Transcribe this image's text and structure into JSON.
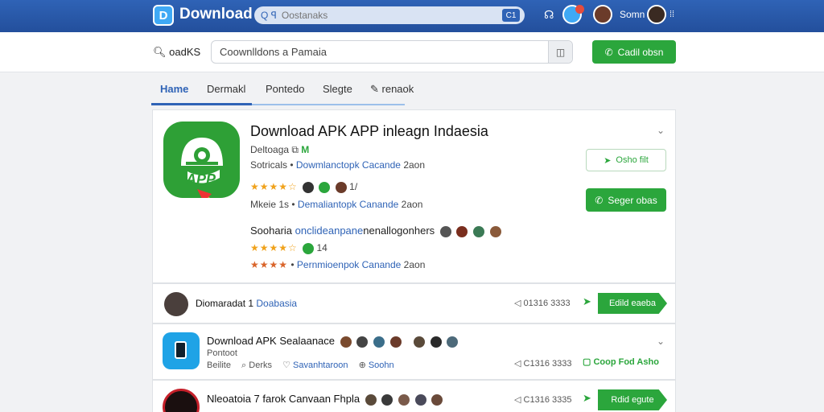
{
  "topbar": {
    "logo_glyph": "D",
    "brand": "Download",
    "search_icon_text": "Q ꟼ",
    "search_placeholder": "Oostanaks",
    "search_btn": "C1",
    "user": "Somn",
    "menu_glyph": "⁞⁞"
  },
  "searchbar": {
    "label": "oadKS",
    "value": "Coownlldons a Pamaia",
    "action_label": "Cadil obsn"
  },
  "tabs": [
    {
      "label": "Hame",
      "active": true
    },
    {
      "label": "Dermakl",
      "active": false
    },
    {
      "label": "Pontedo",
      "active": false
    },
    {
      "label": "Slegte",
      "active": false
    },
    {
      "label": "renaok",
      "active": false
    }
  ],
  "hero": {
    "title": "Download APK APP inleagn Indaesia",
    "meta1_label": "Deltoaga",
    "meta1_tag": "M",
    "meta2_label": "Sotricals",
    "meta2_link": "Dowmlanctopk Cacande",
    "meta2_tail": "2aon",
    "stars1": "★★★★☆",
    "rating_tail": "1/",
    "meta3_label": "Mkeie 1s",
    "meta3_link": "Demaliantopk Canande",
    "meta3_tail": "2aon",
    "desc_prefix": "Sooharia",
    "desc_link": "onclideanpane",
    "desc_tail": "nenallogonhers",
    "stars2": "★★★★☆",
    "count2": "14",
    "stars3": "★★★★",
    "meta4_link": "Pernmioenpok Canande",
    "meta4_tail": "2aon",
    "btn_outline": "Osho filt",
    "btn_green": "Seger obas"
  },
  "rows": [
    {
      "author": "Diomaradat 1",
      "author_link": "Doabasia",
      "stat": "01316 3333",
      "btn": "Edild eaeba"
    },
    {
      "title": "Download APK Sealaanace",
      "sub1": "Pontoot",
      "sub2": "Beilite",
      "tag1": "Derks",
      "tag2": "Savanhtaroon",
      "tag3": "Soohn",
      "stat": "C1316 3333",
      "btn": "Coop Fod Asho"
    },
    {
      "title": "Nleoatoia 7 farok Canvaan Fhpla",
      "stat": "C1316 3335",
      "btn": "Rdid egute"
    }
  ],
  "colors": {
    "brand_blue": "#2f63b6",
    "accent_green": "#2ba63c",
    "star": "#f0a21b"
  }
}
